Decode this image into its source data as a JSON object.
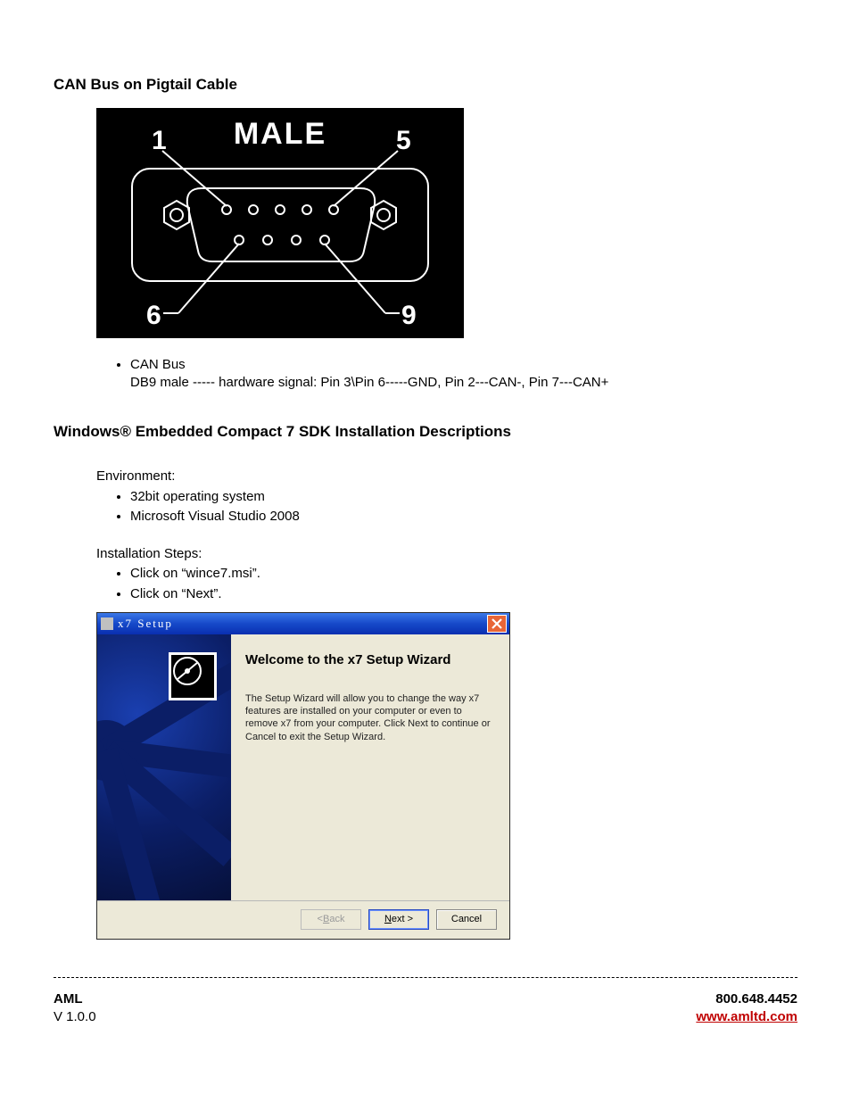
{
  "section1": {
    "heading": "CAN Bus on Pigtail Cable",
    "diagram": {
      "title": "MALE",
      "pin1": "1",
      "pin5": "5",
      "pin6": "6",
      "pin9": "9"
    },
    "bullet_label": "CAN Bus",
    "bullet_detail": "DB9 male  -----  hardware signal: Pin 3\\Pin 6-----GND, Pin 2---CAN-, Pin 7---CAN+"
  },
  "section2": {
    "heading": "Windows® Embedded Compact 7 SDK Installation Descriptions",
    "env_label": "Environment:",
    "env_items": [
      "32bit operating system",
      "Microsoft Visual Studio 2008"
    ],
    "install_label": "Installation Steps:",
    "install_items": [
      "Click on “wince7.msi”.",
      "Click on “Next”."
    ]
  },
  "wizard": {
    "title": "x7 Setup",
    "heading": "Welcome to the x7 Setup Wizard",
    "body": "The Setup Wizard will allow you to change the way x7 features are installed on your computer or even to remove x7 from your computer.  Click Next to continue or Cancel to exit the Setup Wizard.",
    "buttons": {
      "back_pre": "< ",
      "back_u": "B",
      "back_post": "ack",
      "next_u": "N",
      "next_post": "ext >",
      "cancel": "Cancel"
    }
  },
  "footer": {
    "brand": "AML",
    "version": "V 1.0.0",
    "phone": "800.648.4452",
    "url": "www.amltd.com"
  }
}
